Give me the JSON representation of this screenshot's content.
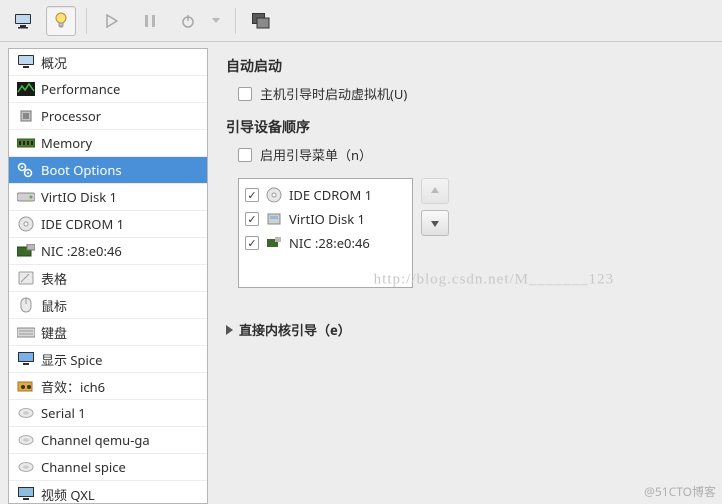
{
  "toolbar": {
    "icons": {
      "monitor": "monitor-icon",
      "bulb": "bulb-icon",
      "play": "play-icon",
      "pause": "pause-icon",
      "power": "power-icon",
      "dropdown": "dropdown-icon",
      "fullscreen": "fullscreen-icon"
    }
  },
  "sidebar": {
    "items": [
      {
        "icon": "monitor-icon",
        "label": "概况"
      },
      {
        "icon": "perf-icon",
        "label": "Performance"
      },
      {
        "icon": "cpu-icon",
        "label": "Processor"
      },
      {
        "icon": "mem-icon",
        "label": "Memory"
      },
      {
        "icon": "boot-icon",
        "label": "Boot Options"
      },
      {
        "icon": "disk-icon",
        "label": "VirtIO Disk 1"
      },
      {
        "icon": "cdrom-icon",
        "label": "IDE CDROM 1"
      },
      {
        "icon": "nic-icon",
        "label": "NIC :28:e0:46"
      },
      {
        "icon": "tablet-icon",
        "label": "表格"
      },
      {
        "icon": "mouse-icon",
        "label": "鼠标"
      },
      {
        "icon": "keyboard-icon",
        "label": "键盘"
      },
      {
        "icon": "display-icon",
        "label": "显示 Spice"
      },
      {
        "icon": "sound-icon",
        "label": "音效：ich6"
      },
      {
        "icon": "serial-icon",
        "label": "Serial 1"
      },
      {
        "icon": "channel-icon",
        "label": "Channel qemu-ga"
      },
      {
        "icon": "channel-icon",
        "label": "Channel spice"
      },
      {
        "icon": "video-icon",
        "label": "视频 QXL"
      }
    ],
    "selected_index": 4
  },
  "main": {
    "autostart": {
      "title": "自动启动",
      "checkbox_label": "主机引导时启动虚拟机(U)",
      "checked": false
    },
    "bootorder": {
      "title": "引导设备顺序",
      "menu_checkbox_label": "启用引导菜单（n）",
      "menu_checked": false,
      "devices": [
        {
          "checked": true,
          "icon": "cdrom-icon",
          "label": "IDE CDROM 1"
        },
        {
          "checked": true,
          "icon": "disk-small-icon",
          "label": "VirtIO Disk 1"
        },
        {
          "checked": true,
          "icon": "nic-small-icon",
          "label": "NIC :28:e0:46"
        }
      ]
    },
    "kernel": {
      "title": "直接内核引导（e）"
    }
  },
  "watermark_center": "http://blog.csdn.net/M_______123",
  "watermark_corner": "@51CTO博客"
}
